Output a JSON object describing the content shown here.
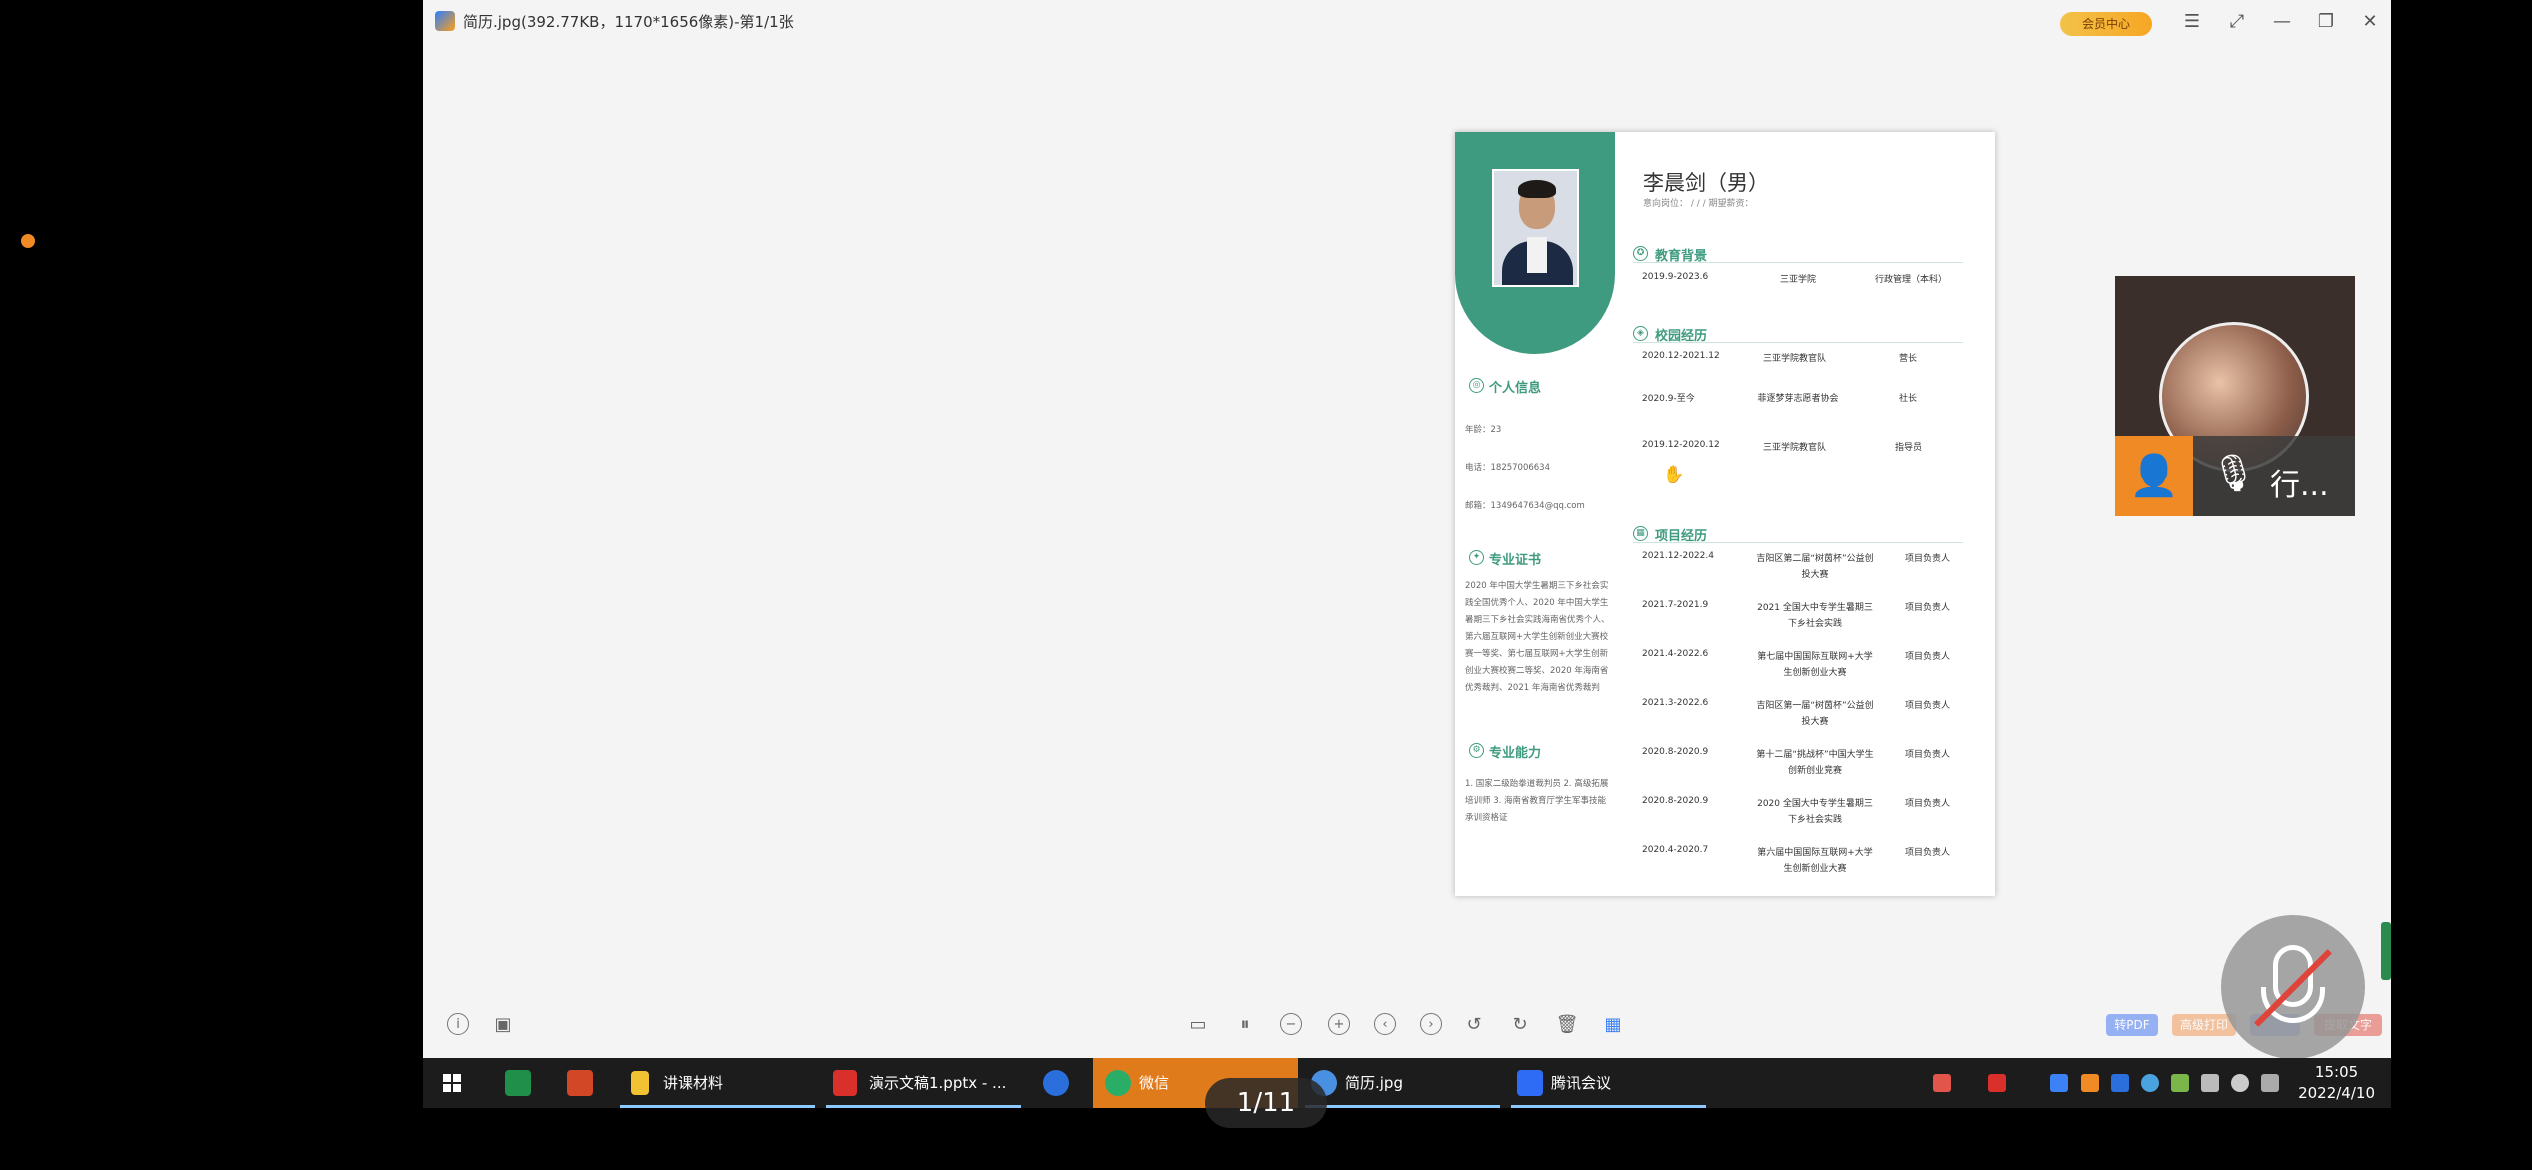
{
  "window": {
    "title": "简历.jpg(392.77KB，1170*1656像素)-第1/1张",
    "vip_label": "会员中心",
    "controls": [
      "menu",
      "fullscreen",
      "minimize",
      "restore",
      "close"
    ]
  },
  "resume": {
    "name": "李晨剑（男）",
    "sub": "意向岗位：  /  /  /  期望薪资：",
    "sections": {
      "personal": {
        "title": "个人信息",
        "age": "年龄：23",
        "phone": "电话：18257006634",
        "email": "邮箱：1349647634@qq.com"
      },
      "cert": {
        "title": "专业证书",
        "text": "2020 年中国大学生暑期三下乡社会实践全国优秀个人、2020 年中国大学生暑期三下乡社会实践海南省优秀个人、第六届互联网+大学生创新创业大赛校赛一等奖、第七届互联网+大学生创新创业大赛校赛二等奖、2020 年海南省优秀裁判、2021 年海南省优秀裁判"
      },
      "ability": {
        "title": "专业能力",
        "text": "1. 国家二级跆拳道裁判员 2. 高级拓展培训师 3. 海南省教育厅学生军事技能承训资格证"
      },
      "education": {
        "title": "教育背景",
        "rows": [
          {
            "date": "2019.9-2023.6",
            "org": "三亚学院",
            "role": "行政管理（本科）"
          }
        ]
      },
      "campus": {
        "title": "校园经历",
        "rows": [
          {
            "date": "2020.12-2021.12",
            "org": "三亚学院教官队",
            "role": "营长"
          },
          {
            "date": "2020.9-至今",
            "org": "菲逐梦芽志愿者协会",
            "role": "社长"
          },
          {
            "date": "2019.12-2020.12",
            "org": "三亚学院教官队",
            "role": "指导员"
          }
        ]
      },
      "project": {
        "title": "项目经历",
        "rows": [
          {
            "date": "2021.12-2022.4",
            "org": "吉阳区第二届“树茵杯”公益创投大赛",
            "role": "项目负责人"
          },
          {
            "date": "2021.7-2021.9",
            "org": "2021 全国大中专学生暑期三下乡社会实践",
            "role": "项目负责人"
          },
          {
            "date": "2021.4-2022.6",
            "org": "第七届中国国际互联网+大学生创新创业大赛",
            "role": "项目负责人"
          },
          {
            "date": "2021.3-2022.6",
            "org": "吉阳区第一届“树茵杯”公益创投大赛",
            "role": "项目负责人"
          },
          {
            "date": "2020.8-2020.9",
            "org": "第十二届“挑战杯”中国大学生创新创业竞赛",
            "role": "项目负责人"
          },
          {
            "date": "2020.8-2020.9",
            "org": "2020 全国大中专学生暑期三下乡社会实践",
            "role": "项目负责人"
          },
          {
            "date": "2020.4-2020.7",
            "org": "第六届中国国际互联网+大学生创新创业大赛",
            "role": "项目负责人"
          }
        ]
      }
    }
  },
  "toolbar": {
    "right_buttons": [
      {
        "label": "转PDF",
        "color": "#4a7cf3"
      },
      {
        "label": "高级打印",
        "color": "#f29a5a"
      },
      {
        "label": "",
        "color": "#4a7cf3"
      },
      {
        "label": "提取文字",
        "color": "#e2554a"
      }
    ]
  },
  "video": {
    "participant_name": "行...",
    "page_indicator": "1/11"
  },
  "taskbar": {
    "items": [
      {
        "label": "讲课材料",
        "icon_color": "#f1c232"
      },
      {
        "label": "演示文稿1.pptx - ...",
        "icon_color": "#d9302c"
      },
      {
        "label": "微信",
        "icon_color": "#2aae67"
      },
      {
        "label": "简历.jpg",
        "icon_color": "#4a90e2"
      },
      {
        "label": "腾讯会议",
        "icon_color": "#2f6cf6"
      }
    ],
    "time": "15:05",
    "date": "2022/4/10"
  }
}
